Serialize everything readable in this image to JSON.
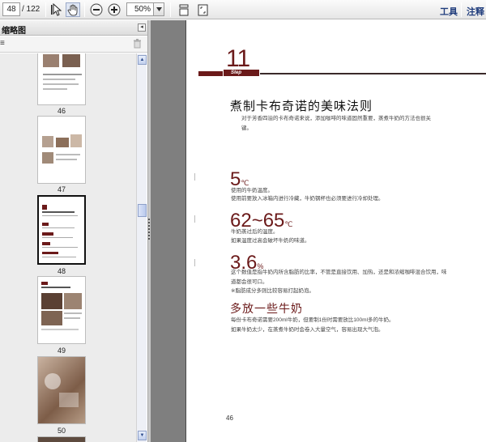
{
  "toolbar": {
    "current_page": "48",
    "total_pages": "/ 122",
    "zoom": "50%",
    "tools_label": "工具",
    "comment_label": "注释"
  },
  "panel": {
    "title": "缩略图",
    "close_glyph": "◂",
    "options_glyph": "≡"
  },
  "thumbnails": [
    {
      "page": "46"
    },
    {
      "page": "47"
    },
    {
      "page": "48"
    },
    {
      "page": "49"
    },
    {
      "page": "50"
    }
  ],
  "document": {
    "step_number": "11",
    "step_label": "Step",
    "title": "煮制卡布奇诺的美味法则",
    "intro": "对于芳香四溢的卡布奇诺来说，添加咖啡的味道固然重要，蒸煮牛奶的方法也很关键。",
    "stat1_value": "5",
    "stat1_unit": "℃",
    "stat1_text_1": "使用的牛奶温度。",
    "stat1_text_2": "使用前要放入冰箱内进行冷藏，牛奶钢杯也必须要进行冷却处理。",
    "stat2_value": "62~65",
    "stat2_unit": "℃",
    "stat2_text_1": "牛奶蒸过后的温度。",
    "stat2_text_2": "如果温度过高会破坏牛奶的味道。",
    "stat3_value": "3.6",
    "stat3_unit": "%",
    "stat3_text_1": "这个数值是指牛奶内所含脂肪的比率，不管是直接饮用、加热，还是和浓缩咖啡混合饮用，味道都会很可口。",
    "stat3_text_2": "※脂肪成分多则比较容易打起奶泡。",
    "subtitle": "多放一些牛奶",
    "tip_1": "每份卡布奇诺需要200ml牛奶，但要制1份时需要放比100ml多的牛奶。",
    "tip_2": "如果牛奶太少，在蒸煮牛奶时会卷入大量空气，容易出现大气泡。",
    "page_number": "46"
  },
  "colors": {
    "accent": "#6b1a1a",
    "doc_background": "#7f7f7f"
  }
}
